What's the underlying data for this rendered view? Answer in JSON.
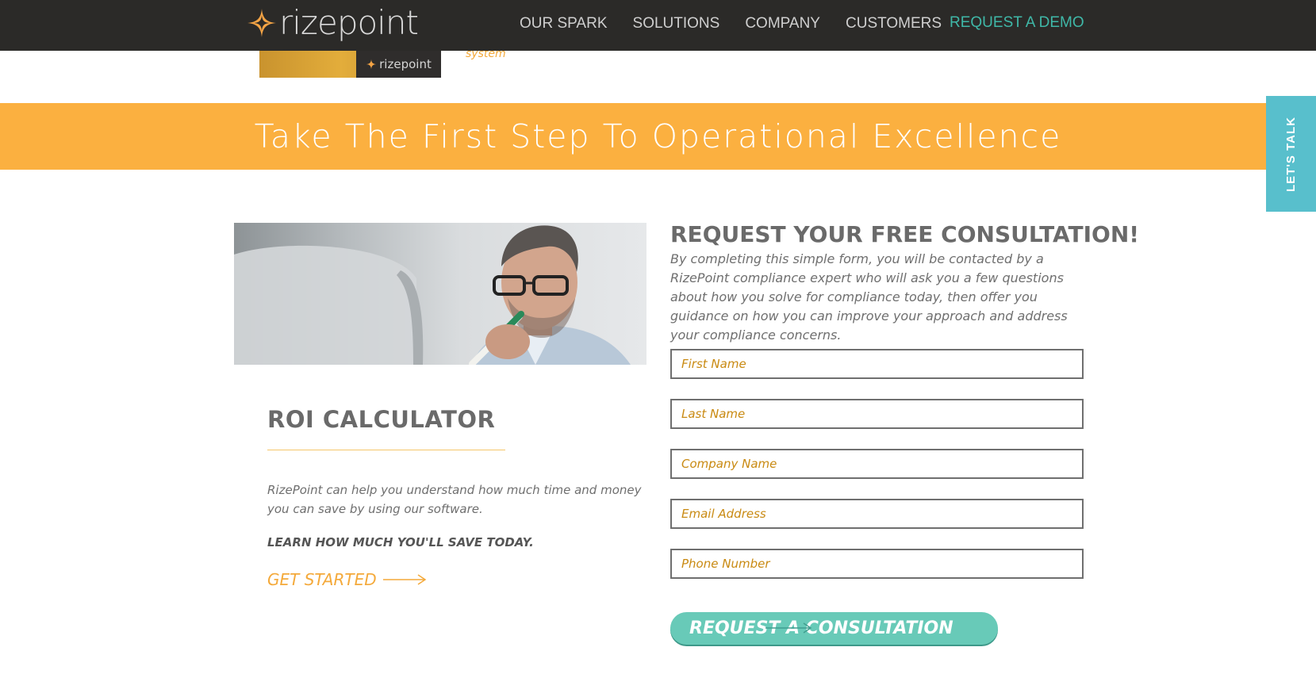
{
  "nav": {
    "logo_text": "rizepoint",
    "links": [
      "OUR SPARK",
      "SOLUTIONS",
      "COMPANY",
      "CUSTOMERS"
    ],
    "cta": "REQUEST A DEMO"
  },
  "peek": {
    "badge_text": "rizepoint",
    "caption": "system"
  },
  "banner": {
    "title": "Take The First Step To Operational Excellence"
  },
  "side_tab": {
    "label": "LET'S TALK"
  },
  "roi": {
    "title": "ROI CALCULATOR",
    "description": "RizePoint can help you understand how much time and money you can save by using our software.",
    "emphasis": "LEARN HOW MUCH YOU'LL SAVE TODAY.",
    "cta": "GET STARTED"
  },
  "form": {
    "title": "REQUEST YOUR FREE CONSULTATION!",
    "description": "By completing this simple form, you will be contacted by a RizePoint compliance expert who will ask you a few questions about how you solve for compliance today, then offer you guidance on how you can improve your approach and address your compliance concerns.",
    "fields": [
      {
        "placeholder": "First Name",
        "value": ""
      },
      {
        "placeholder": "Last Name",
        "value": ""
      },
      {
        "placeholder": "Company Name",
        "value": ""
      },
      {
        "placeholder": "Email Address",
        "value": ""
      },
      {
        "placeholder": "Phone Number",
        "value": ""
      }
    ],
    "submit_label": "REQUEST A CONSULTATION"
  },
  "colors": {
    "nav_bg": "#2b2a28",
    "accent_orange": "#fbb040",
    "accent_teal": "#68cab8",
    "side_tab": "#58bfcc",
    "cta_text": "#3fb8a8"
  },
  "icons": [
    "rizepoint-star-icon",
    "arrow-right-icon"
  ]
}
